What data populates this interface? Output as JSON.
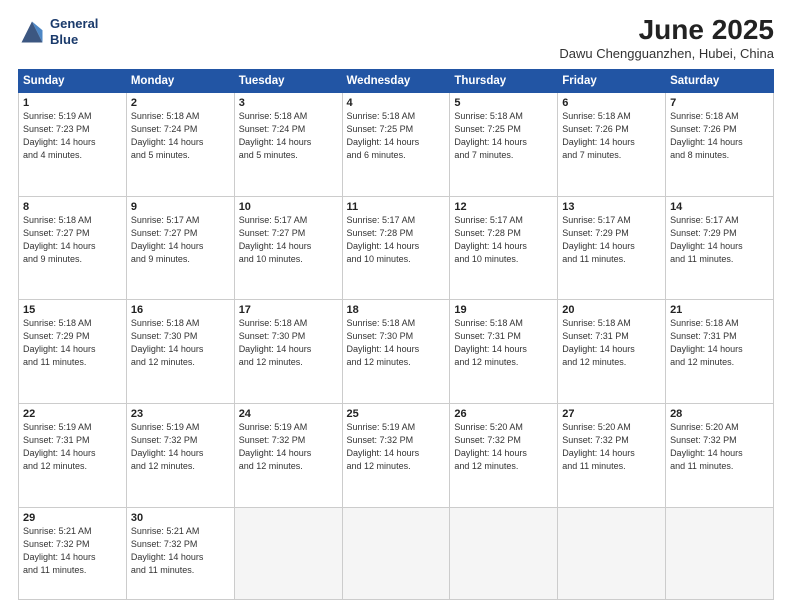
{
  "header": {
    "logo_line1": "General",
    "logo_line2": "Blue",
    "month_title": "June 2025",
    "location": "Dawu Chengguanzhen, Hubei, China"
  },
  "days_of_week": [
    "Sunday",
    "Monday",
    "Tuesday",
    "Wednesday",
    "Thursday",
    "Friday",
    "Saturday"
  ],
  "weeks": [
    [
      {
        "day": 1,
        "lines": [
          "Sunrise: 5:19 AM",
          "Sunset: 7:23 PM",
          "Daylight: 14 hours",
          "and 4 minutes."
        ]
      },
      {
        "day": 2,
        "lines": [
          "Sunrise: 5:18 AM",
          "Sunset: 7:24 PM",
          "Daylight: 14 hours",
          "and 5 minutes."
        ]
      },
      {
        "day": 3,
        "lines": [
          "Sunrise: 5:18 AM",
          "Sunset: 7:24 PM",
          "Daylight: 14 hours",
          "and 5 minutes."
        ]
      },
      {
        "day": 4,
        "lines": [
          "Sunrise: 5:18 AM",
          "Sunset: 7:25 PM",
          "Daylight: 14 hours",
          "and 6 minutes."
        ]
      },
      {
        "day": 5,
        "lines": [
          "Sunrise: 5:18 AM",
          "Sunset: 7:25 PM",
          "Daylight: 14 hours",
          "and 7 minutes."
        ]
      },
      {
        "day": 6,
        "lines": [
          "Sunrise: 5:18 AM",
          "Sunset: 7:26 PM",
          "Daylight: 14 hours",
          "and 7 minutes."
        ]
      },
      {
        "day": 7,
        "lines": [
          "Sunrise: 5:18 AM",
          "Sunset: 7:26 PM",
          "Daylight: 14 hours",
          "and 8 minutes."
        ]
      }
    ],
    [
      {
        "day": 8,
        "lines": [
          "Sunrise: 5:18 AM",
          "Sunset: 7:27 PM",
          "Daylight: 14 hours",
          "and 9 minutes."
        ]
      },
      {
        "day": 9,
        "lines": [
          "Sunrise: 5:17 AM",
          "Sunset: 7:27 PM",
          "Daylight: 14 hours",
          "and 9 minutes."
        ]
      },
      {
        "day": 10,
        "lines": [
          "Sunrise: 5:17 AM",
          "Sunset: 7:27 PM",
          "Daylight: 14 hours",
          "and 10 minutes."
        ]
      },
      {
        "day": 11,
        "lines": [
          "Sunrise: 5:17 AM",
          "Sunset: 7:28 PM",
          "Daylight: 14 hours",
          "and 10 minutes."
        ]
      },
      {
        "day": 12,
        "lines": [
          "Sunrise: 5:17 AM",
          "Sunset: 7:28 PM",
          "Daylight: 14 hours",
          "and 10 minutes."
        ]
      },
      {
        "day": 13,
        "lines": [
          "Sunrise: 5:17 AM",
          "Sunset: 7:29 PM",
          "Daylight: 14 hours",
          "and 11 minutes."
        ]
      },
      {
        "day": 14,
        "lines": [
          "Sunrise: 5:17 AM",
          "Sunset: 7:29 PM",
          "Daylight: 14 hours",
          "and 11 minutes."
        ]
      }
    ],
    [
      {
        "day": 15,
        "lines": [
          "Sunrise: 5:18 AM",
          "Sunset: 7:29 PM",
          "Daylight: 14 hours",
          "and 11 minutes."
        ]
      },
      {
        "day": 16,
        "lines": [
          "Sunrise: 5:18 AM",
          "Sunset: 7:30 PM",
          "Daylight: 14 hours",
          "and 12 minutes."
        ]
      },
      {
        "day": 17,
        "lines": [
          "Sunrise: 5:18 AM",
          "Sunset: 7:30 PM",
          "Daylight: 14 hours",
          "and 12 minutes."
        ]
      },
      {
        "day": 18,
        "lines": [
          "Sunrise: 5:18 AM",
          "Sunset: 7:30 PM",
          "Daylight: 14 hours",
          "and 12 minutes."
        ]
      },
      {
        "day": 19,
        "lines": [
          "Sunrise: 5:18 AM",
          "Sunset: 7:31 PM",
          "Daylight: 14 hours",
          "and 12 minutes."
        ]
      },
      {
        "day": 20,
        "lines": [
          "Sunrise: 5:18 AM",
          "Sunset: 7:31 PM",
          "Daylight: 14 hours",
          "and 12 minutes."
        ]
      },
      {
        "day": 21,
        "lines": [
          "Sunrise: 5:18 AM",
          "Sunset: 7:31 PM",
          "Daylight: 14 hours",
          "and 12 minutes."
        ]
      }
    ],
    [
      {
        "day": 22,
        "lines": [
          "Sunrise: 5:19 AM",
          "Sunset: 7:31 PM",
          "Daylight: 14 hours",
          "and 12 minutes."
        ]
      },
      {
        "day": 23,
        "lines": [
          "Sunrise: 5:19 AM",
          "Sunset: 7:32 PM",
          "Daylight: 14 hours",
          "and 12 minutes."
        ]
      },
      {
        "day": 24,
        "lines": [
          "Sunrise: 5:19 AM",
          "Sunset: 7:32 PM",
          "Daylight: 14 hours",
          "and 12 minutes."
        ]
      },
      {
        "day": 25,
        "lines": [
          "Sunrise: 5:19 AM",
          "Sunset: 7:32 PM",
          "Daylight: 14 hours",
          "and 12 minutes."
        ]
      },
      {
        "day": 26,
        "lines": [
          "Sunrise: 5:20 AM",
          "Sunset: 7:32 PM",
          "Daylight: 14 hours",
          "and 12 minutes."
        ]
      },
      {
        "day": 27,
        "lines": [
          "Sunrise: 5:20 AM",
          "Sunset: 7:32 PM",
          "Daylight: 14 hours",
          "and 11 minutes."
        ]
      },
      {
        "day": 28,
        "lines": [
          "Sunrise: 5:20 AM",
          "Sunset: 7:32 PM",
          "Daylight: 14 hours",
          "and 11 minutes."
        ]
      }
    ],
    [
      {
        "day": 29,
        "lines": [
          "Sunrise: 5:21 AM",
          "Sunset: 7:32 PM",
          "Daylight: 14 hours",
          "and 11 minutes."
        ]
      },
      {
        "day": 30,
        "lines": [
          "Sunrise: 5:21 AM",
          "Sunset: 7:32 PM",
          "Daylight: 14 hours",
          "and 11 minutes."
        ]
      },
      {
        "day": null,
        "lines": []
      },
      {
        "day": null,
        "lines": []
      },
      {
        "day": null,
        "lines": []
      },
      {
        "day": null,
        "lines": []
      },
      {
        "day": null,
        "lines": []
      }
    ]
  ]
}
